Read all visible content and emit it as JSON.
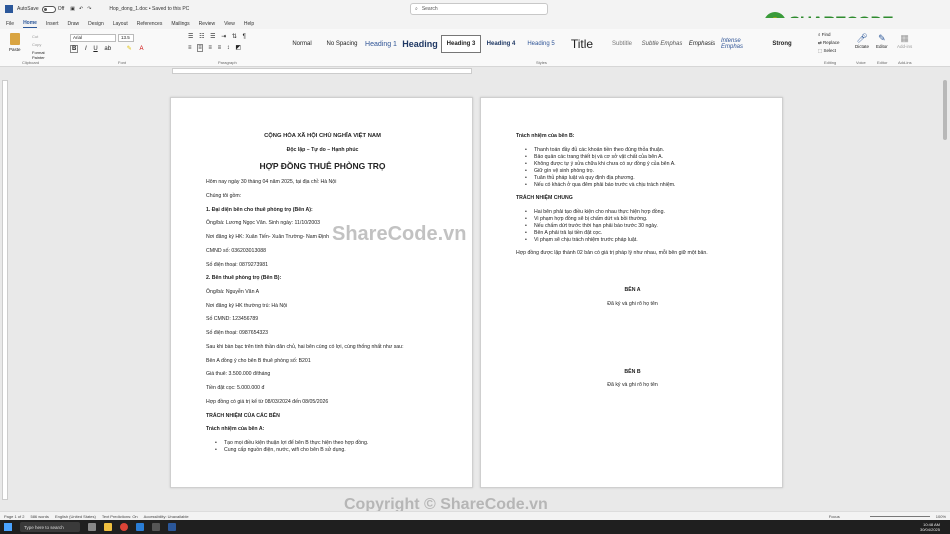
{
  "titlebar": {
    "autosave_label": "AutoSave",
    "toggle_state": "Off",
    "doc_title": "Hop_dong_1.doc • Saved to this PC",
    "search_placeholder": "Search"
  },
  "menu": {
    "items": [
      "File",
      "Home",
      "Insert",
      "Draw",
      "Design",
      "Layout",
      "References",
      "Mailings",
      "Review",
      "View",
      "Help"
    ],
    "active": "Home"
  },
  "ribbon": {
    "clipboard": {
      "paste": "Paste",
      "cut": "Cut",
      "copy": "Copy",
      "format_painter": "Format Painter",
      "label": "Clipboard"
    },
    "font": {
      "name": "Arial",
      "size": "13.5",
      "label": "Font"
    },
    "paragraph_label": "Paragraph",
    "styles_label": "Styles",
    "styles": [
      "Normal",
      "No Spacing",
      "Heading 1",
      "Heading",
      "Heading 3",
      "Heading 4",
      "Heading 5",
      "Title",
      "Subtitle",
      "Subtle Emphas",
      "Emphasis",
      "Intense Emphas",
      "Strong"
    ],
    "editing": {
      "find": "Find",
      "replace": "Replace",
      "select": "Select",
      "label": "Editing"
    },
    "voice": {
      "dictate": "Dictate",
      "label": "Voice"
    },
    "editor": {
      "editor": "Editor",
      "label": "Editor"
    },
    "addins": {
      "addins": "Add-ins",
      "label": "Add-ins"
    }
  },
  "logo": {
    "text": "SHARECODE.vn"
  },
  "watermarks": {
    "center": "ShareCode.vn",
    "bottom": "Copyright © ShareCode.vn"
  },
  "page1": {
    "national_title": "CỘNG HÒA XÃ HỘI CHỦ NGHĨA VIỆT NAM",
    "motto": "Độc lập – Tự do – Hạnh phúc",
    "contract_title": "HỢP ĐỒNG THUÊ PHÒNG TRỌ",
    "date_line": "Hôm nay ngày 30 tháng 04 năm 2025, tại địa chỉ: Hà Nội",
    "parties_intro": "Chúng tôi gồm:",
    "party_a_heading": "1. Đại diện bên cho thuê phòng trọ (Bên A):",
    "party_a_name": "Ông/bà: Lương Ngọc Văn. Sinh ngày: 11/10/2003",
    "party_a_address": "Nơi đăng ký HK: Xuân Tiến- Xuân Trường- Nam Định",
    "party_a_id": "CMND số: 036203013088",
    "party_a_phone": "Số điện thoại: 0879273981",
    "party_b_heading": "2. Bên thuê phòng trọ (Bên B):",
    "party_b_name": "Ông/bà: Nguyễn Văn A",
    "party_b_address": "Nơi đăng ký HK thường trú: Hà Nội",
    "party_b_id": "Số CMND: 123456789",
    "party_b_phone": "Số điện thoại: 0987654323",
    "agreement": "Sau khi bàn bạc trên tinh thần dân chủ, hai bên cùng có lợi, cùng thống nhất như sau:",
    "room": "Bên A đồng ý cho bên B thuê phòng số: B201",
    "price": "Giá thuê: 3.500.000 đ/tháng",
    "deposit": "Tiền đặt cọc: 5.000.000 đ",
    "validity": "Hợp đồng có giá trị kể từ 08/03/2024 đến 08/05/2026",
    "responsibility_heading": "TRÁCH NHIỆM CỦA CÁC BÊN",
    "party_a_resp_heading": "Trách nhiệm của bên A:",
    "party_a_resp": [
      "Tạo mọi điều kiện thuận lợi để bên B thực hiện theo hợp đồng.",
      "Cung cấp nguồn điện, nước, wifi cho bên B sử dụng."
    ]
  },
  "page2": {
    "party_b_resp_heading": "Trách nhiệm của bên B:",
    "party_b_resp": [
      "Thanh toán đầy đủ các khoản tiền theo đúng thỏa thuận.",
      "Bảo quản các trang thiết bị và cơ sở vật chất của bên A.",
      "Không được tự ý sửa chữa khi chưa có sự đồng ý của bên A.",
      "Giữ gìn vệ sinh phòng trọ.",
      "Tuân thủ pháp luật và quy định địa phương.",
      "Nếu có khách ở qua đêm phải báo trước và chịu trách nhiệm."
    ],
    "common_heading": "TRÁCH NHIỆM CHUNG",
    "common_resp": [
      "Hai bên phải tạo điều kiện cho nhau thực hiện hợp đồng.",
      "Vi phạm hợp đồng sẽ bị chấm dứt và bồi thường.",
      "Nếu chấm dứt trước thời hạn phải báo trước 30 ngày.",
      "Bên A phải trả lại tiền đặt cọc.",
      "Vi phạm sẽ chịu trách nhiệm trước pháp luật."
    ],
    "copies": "Hợp đồng được lập thành 02 bản có giá trị pháp lý như nhau, mỗi bên giữ một bản.",
    "sign_a_title": "BÊN A",
    "sign_a_note": "Đã ký và ghi rõ họ tên",
    "sign_b_title": "BÊN B",
    "sign_b_note": "Đã ký và ghi rõ họ tên"
  },
  "status": {
    "page": "Page 1 of 2",
    "words": "586 words",
    "language": "English (United States)",
    "predictions": "Text Predictions: On",
    "accessibility": "Accessibility: Unavailable",
    "focus": "Focus",
    "zoom": "100%"
  },
  "taskbar": {
    "search": "Type here to search",
    "time": "10:48 AM",
    "date": "30/04/2025"
  }
}
